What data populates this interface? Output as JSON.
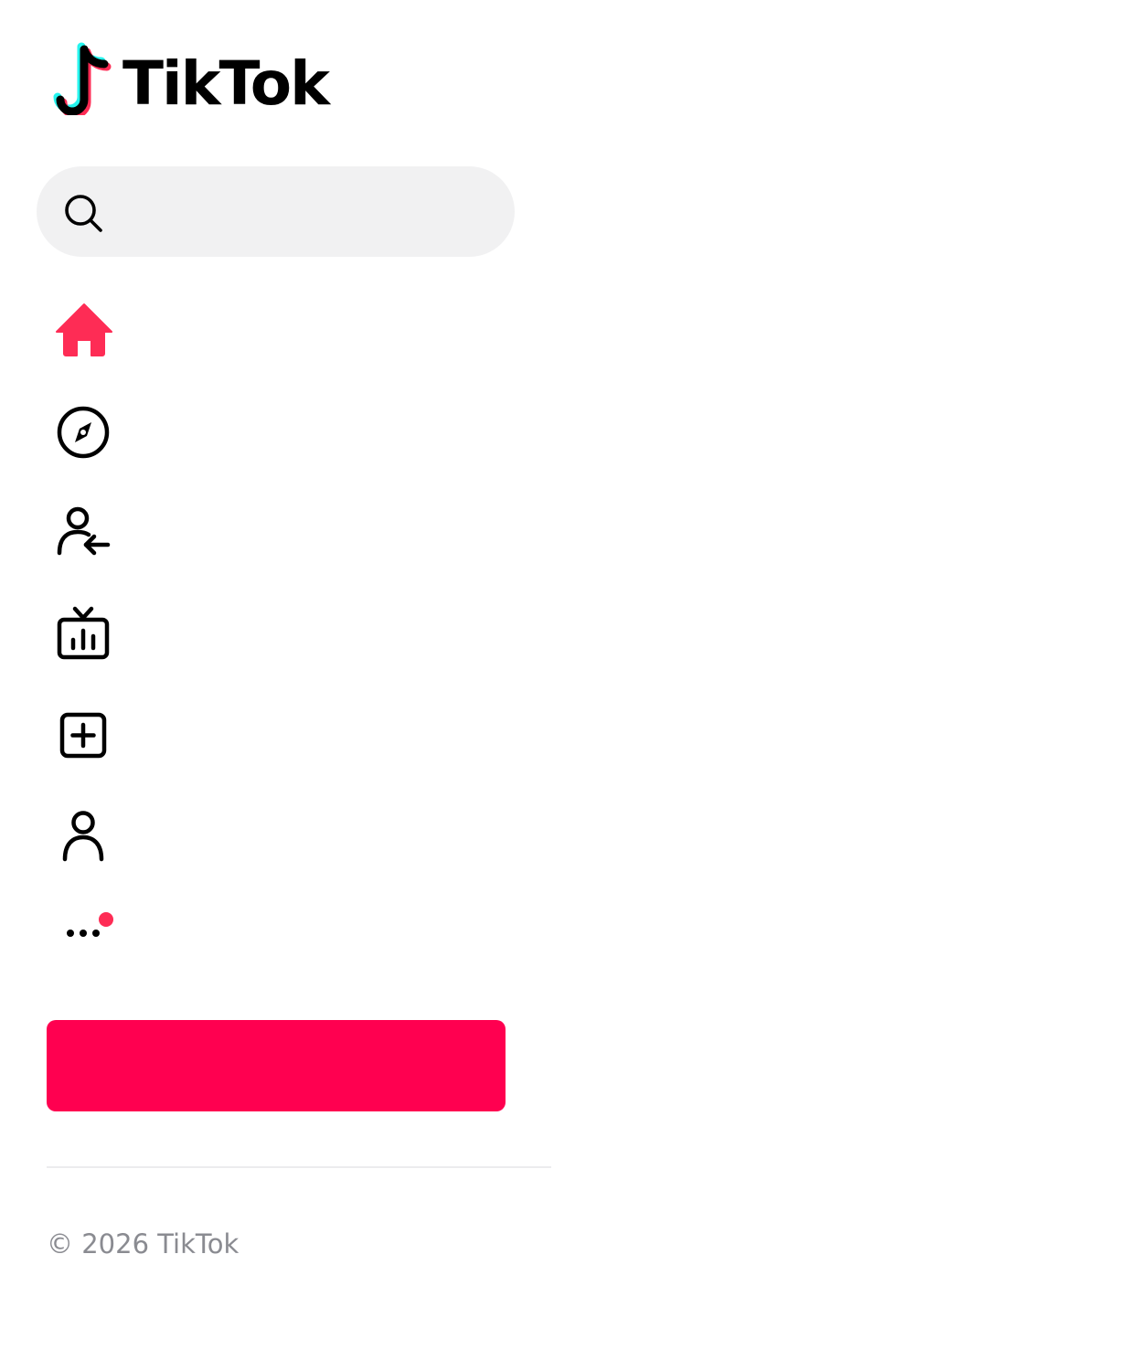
{
  "brand": {
    "name": "TikTok",
    "colors": {
      "accent": "#fe2c55",
      "primary_button": "#ff0050",
      "logo_cyan": "#25f4ee",
      "logo_red": "#fe2c55",
      "text": "#000000",
      "search_bg": "#f1f1f2",
      "muted_text": "#8a8b91",
      "divider": "#ececee"
    }
  },
  "search": {
    "icon": "search-icon",
    "value": "",
    "placeholder": ""
  },
  "nav": {
    "items": [
      {
        "id": "home",
        "icon": "home-icon",
        "active": true
      },
      {
        "id": "explore",
        "icon": "compass-icon",
        "active": false
      },
      {
        "id": "following",
        "icon": "user-follow-icon",
        "active": false
      },
      {
        "id": "live",
        "icon": "tv-live-icon",
        "active": false
      },
      {
        "id": "upload",
        "icon": "plus-square-icon",
        "active": false
      },
      {
        "id": "profile",
        "icon": "user-icon",
        "active": false
      },
      {
        "id": "more",
        "icon": "more-dots-icon",
        "active": false,
        "has_notification_dot": true
      }
    ]
  },
  "login_button": {
    "label": ""
  },
  "footer": {
    "copyright": "© 2026 TikTok"
  }
}
